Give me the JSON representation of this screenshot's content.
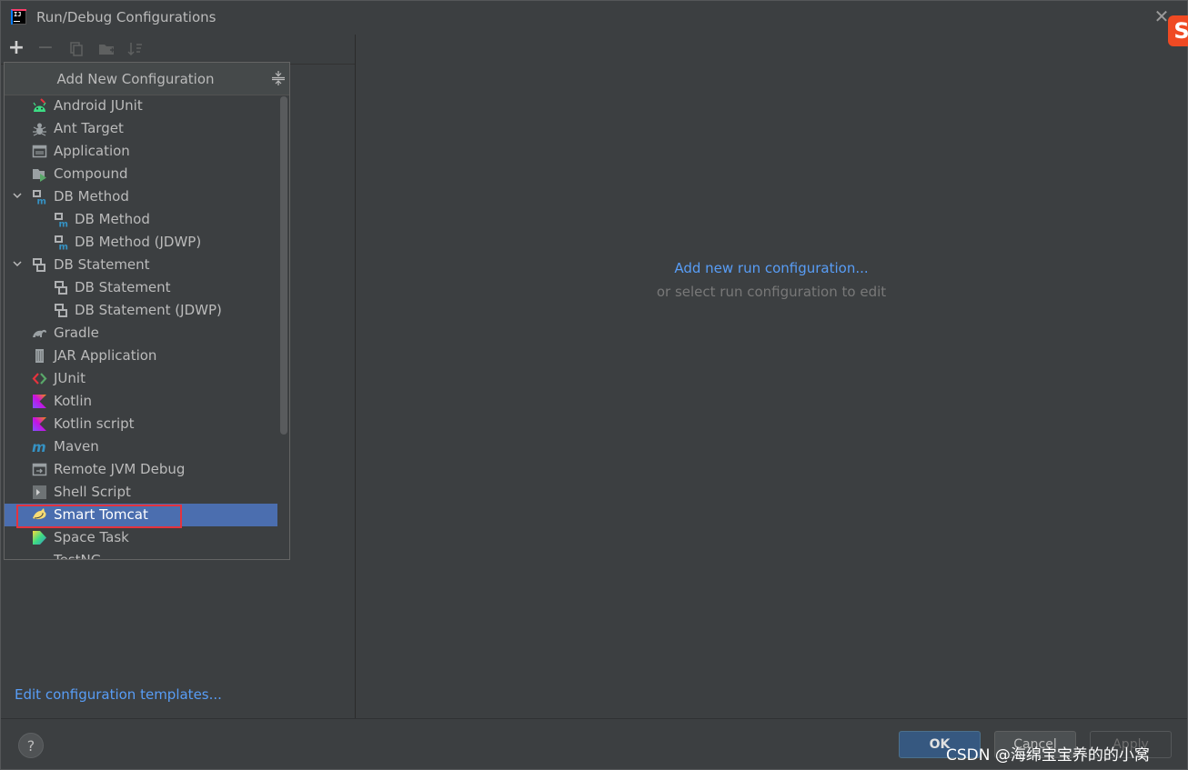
{
  "window": {
    "title": "Run/Debug Configurations"
  },
  "popup": {
    "title": "Add New Configuration",
    "items": [
      {
        "label": "Android JUnit",
        "icon": "android-junit-icon",
        "level": 1
      },
      {
        "label": "Ant Target",
        "icon": "ant-icon",
        "level": 1
      },
      {
        "label": "Application",
        "icon": "application-icon",
        "level": 1
      },
      {
        "label": "Compound",
        "icon": "compound-icon",
        "level": 1
      },
      {
        "label": "DB Method",
        "icon": "db-method-icon",
        "level": 1,
        "expandable": true
      },
      {
        "label": "DB Method",
        "icon": "db-method-icon",
        "level": 2
      },
      {
        "label": "DB Method (JDWP)",
        "icon": "db-method-icon",
        "level": 2
      },
      {
        "label": "DB Statement",
        "icon": "db-statement-icon",
        "level": 1,
        "expandable": true
      },
      {
        "label": "DB Statement",
        "icon": "db-statement-icon",
        "level": 2
      },
      {
        "label": "DB Statement (JDWP)",
        "icon": "db-statement-icon",
        "level": 2
      },
      {
        "label": "Gradle",
        "icon": "gradle-icon",
        "level": 1
      },
      {
        "label": "JAR Application",
        "icon": "jar-icon",
        "level": 1
      },
      {
        "label": "JUnit",
        "icon": "junit-icon",
        "level": 1
      },
      {
        "label": "Kotlin",
        "icon": "kotlin-icon",
        "level": 1
      },
      {
        "label": "Kotlin script",
        "icon": "kotlin-icon",
        "level": 1
      },
      {
        "label": "Maven",
        "icon": "maven-icon",
        "level": 1
      },
      {
        "label": "Remote JVM Debug",
        "icon": "remote-debug-icon",
        "level": 1
      },
      {
        "label": "Shell Script",
        "icon": "shell-script-icon",
        "level": 1
      },
      {
        "label": "Smart Tomcat",
        "icon": "tomcat-icon",
        "level": 1,
        "selected": true
      },
      {
        "label": "Space Task",
        "icon": "space-icon",
        "level": 1
      },
      {
        "label": "TestNG",
        "icon": "testng-icon",
        "level": 1
      }
    ]
  },
  "left": {
    "edit_templates": "Edit configuration templates..."
  },
  "right": {
    "add_new": "Add new run configuration...",
    "or_select": "or select run configuration to edit"
  },
  "buttons": {
    "ok": "OK",
    "cancel": "Cancel",
    "apply": "Apply",
    "help": "?"
  },
  "watermark": "CSDN @海绵宝宝养的的小窝",
  "colors": {
    "background": "#3c3f41",
    "link": "#589df6",
    "selection": "#4b6eaf",
    "highlight": "#e5333d"
  }
}
